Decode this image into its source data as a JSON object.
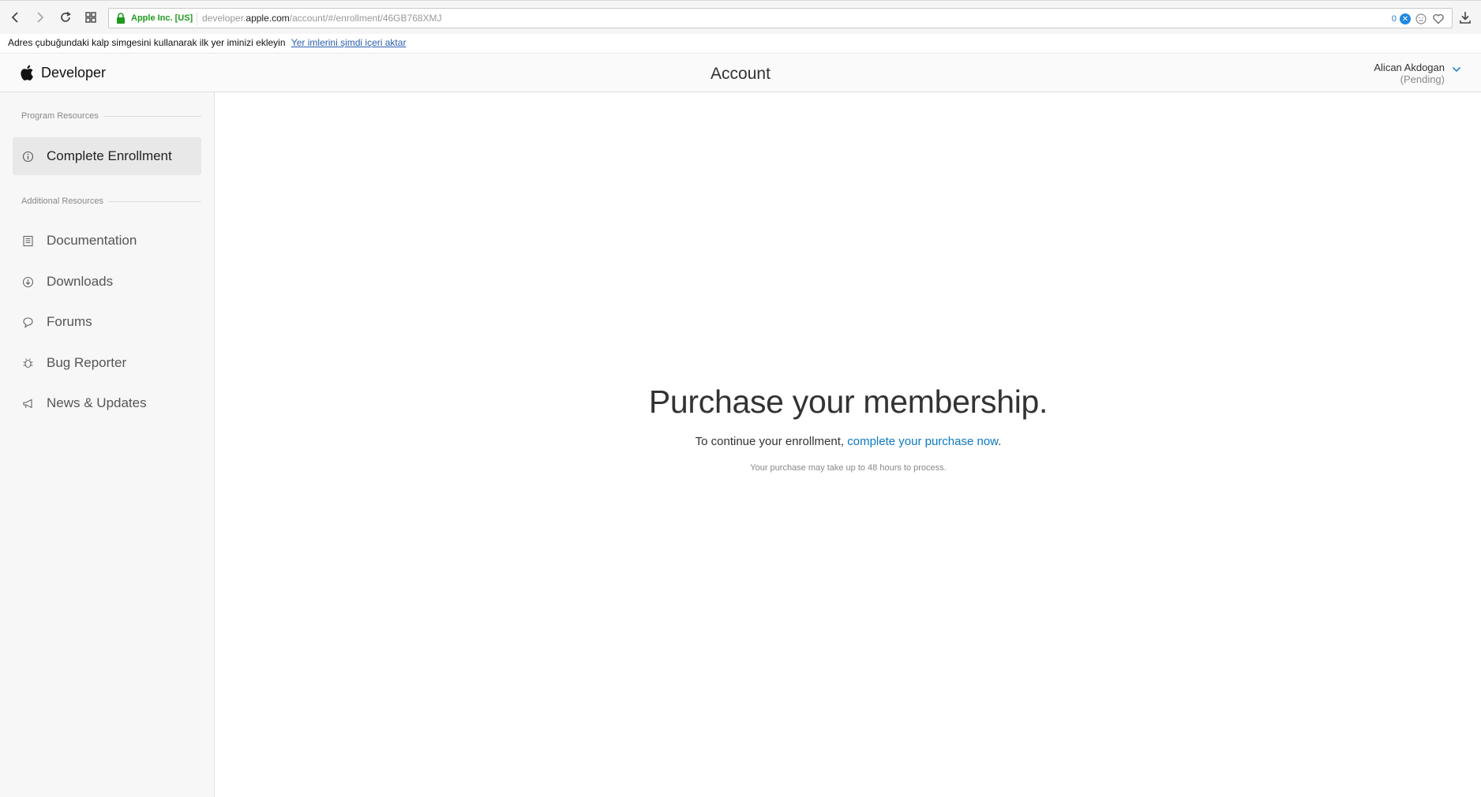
{
  "browser": {
    "site_identity": "Apple Inc. [US]",
    "url_prefix": "developer.",
    "url_host": "apple.com",
    "url_path": "/account/#/enrollment/46GB768XMJ",
    "block_count": "0",
    "block_badge": "✕"
  },
  "notice": {
    "text": "Adres çubuğundaki kalp simgesini kullanarak ilk yer iminizi ekleyin",
    "link": "Yer imlerini şimdi içeri aktar"
  },
  "header": {
    "brand": "Developer",
    "title": "Account",
    "user_name": "Alican Akdogan",
    "user_status": "(Pending)"
  },
  "sidebar": {
    "program_label": "Program Resources",
    "additional_label": "Additional Resources",
    "program_items": [
      {
        "label": "Complete Enrollment",
        "icon": "info-icon"
      }
    ],
    "additional_items": [
      {
        "label": "Documentation",
        "icon": "document-icon"
      },
      {
        "label": "Downloads",
        "icon": "download-circle-icon"
      },
      {
        "label": "Forums",
        "icon": "speech-bubble-icon"
      },
      {
        "label": "Bug Reporter",
        "icon": "bug-icon"
      },
      {
        "label": "News & Updates",
        "icon": "megaphone-icon"
      }
    ]
  },
  "main": {
    "headline": "Purchase your membership.",
    "sub_prefix": "To continue your enrollment, ",
    "sub_link": "complete your purchase now",
    "sub_suffix": ".",
    "note": "Your purchase may take up to 48 hours to process."
  },
  "colors": {
    "link": "#0a7ac4",
    "secure": "#1f9a1f",
    "sidebar_bg": "#f7f7f7"
  }
}
